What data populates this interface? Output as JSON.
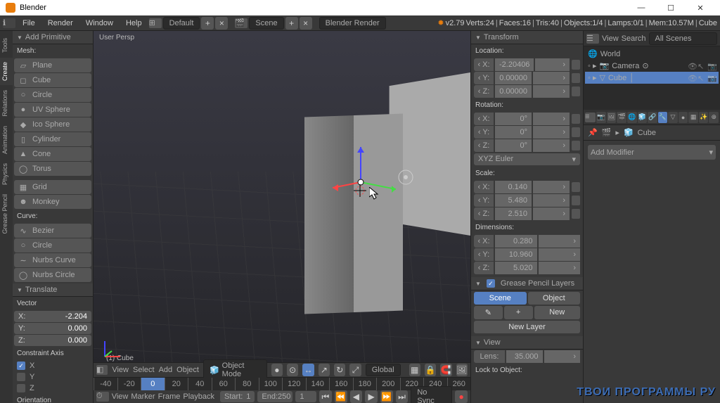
{
  "title": "Blender",
  "menu": {
    "file": "File",
    "render": "Render",
    "window": "Window",
    "help": "Help",
    "layout": "Default",
    "scene": "Scene",
    "engine": "Blender Render"
  },
  "stats": {
    "version": "v2.79",
    "verts": "Verts:24",
    "faces": "Faces:16",
    "tris": "Tris:40",
    "objects": "Objects:1/4",
    "lamps": "Lamps:0/1",
    "mem": "Mem:10.57M",
    "obj": "Cube"
  },
  "addprim": {
    "title": "Add Primitive",
    "mesh": "Mesh:",
    "curve": "Curve:",
    "items": [
      "Plane",
      "Cube",
      "Circle",
      "UV Sphere",
      "Ico Sphere",
      "Cylinder",
      "Cone",
      "Torus",
      "Grid",
      "Monkey"
    ],
    "curves": [
      "Bezier",
      "Circle",
      "Nurbs Curve",
      "Nurbs Circle"
    ]
  },
  "translate": {
    "title": "Translate",
    "vector": "Vector",
    "x": "-2.204",
    "y": "0.000",
    "z": "0.000",
    "caxis": "Constraint Axis",
    "ax": "X",
    "ay": "Y",
    "az": "Z",
    "orient": "Orientation"
  },
  "viewport": {
    "label": "User Persp",
    "object": "(1) Cube"
  },
  "vpmenu": {
    "view": "View",
    "select": "Select",
    "add": "Add",
    "object": "Object",
    "mode": "Object Mode",
    "global": "Global"
  },
  "timeline": {
    "marks": [
      "-40",
      "-20",
      "0",
      "20",
      "40",
      "60",
      "80",
      "100",
      "120",
      "140",
      "160",
      "180",
      "200",
      "220",
      "240",
      "260"
    ],
    "view": "View",
    "marker": "Marker",
    "frame": "Frame",
    "playback": "Playback",
    "start": "1",
    "end": "250",
    "nosync": "No Sync",
    "current": "1"
  },
  "transform": {
    "title": "Transform",
    "location": "Location:",
    "rotation": "Rotation:",
    "scale": "Scale:",
    "dims": "Dimensions:",
    "loc": {
      "x": "-2.20406",
      "y": "0.00000",
      "z": "0.00000"
    },
    "rot": {
      "x": "0°",
      "y": "0°",
      "z": "0°"
    },
    "rotmode": "XYZ Euler",
    "scl": {
      "x": "0.140",
      "y": "5.480",
      "z": "2.510"
    },
    "dim": {
      "x": "0.280",
      "y": "10.960",
      "z": "5.020"
    }
  },
  "gpencil": {
    "title": "Grease Pencil Layers",
    "scene": "Scene",
    "object": "Object",
    "new": "New",
    "newlayer": "New Layer"
  },
  "view": {
    "title": "View",
    "lens": "Lens:",
    "lensval": "35.000",
    "lock": "Lock to Object:"
  },
  "outliner": {
    "view": "View",
    "search": "Search",
    "filter": "All Scenes",
    "world": "World",
    "camera": "Camera",
    "cube": "Cube"
  },
  "props": {
    "cube": "Cube",
    "modifier": "Add Modifier"
  },
  "sidetabs": [
    "Tools",
    "Create",
    "Relations",
    "Animation",
    "Physics",
    "Grease Pencil"
  ],
  "watermark": "ТВОИ ПРОГРАММЫ РУ",
  "axis": {
    "x": "X:",
    "y": "Y:",
    "z": "Z:"
  }
}
